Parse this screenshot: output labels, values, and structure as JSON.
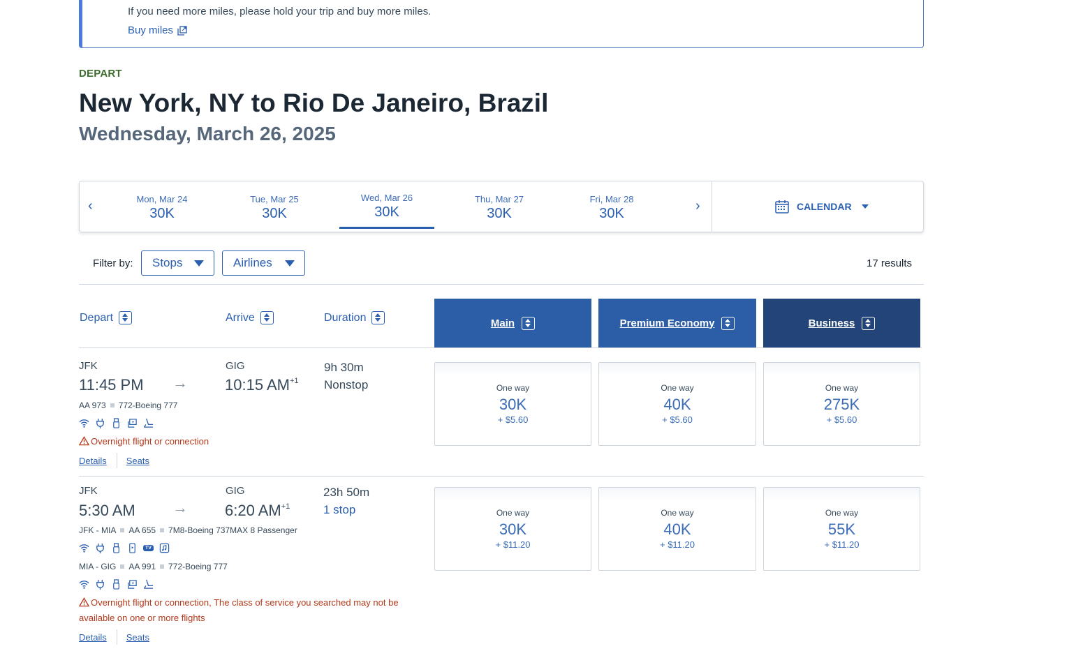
{
  "notice": {
    "text": "If you need more miles, please hold your trip and buy more miles.",
    "link": "Buy miles",
    "link_icon": "external-link-icon"
  },
  "header": {
    "depart_label": "DEPART",
    "title": "New York, NY to Rio De Janeiro, Brazil",
    "date": "Wednesday, March 26, 2025"
  },
  "date_strip": {
    "days": [
      {
        "label": "Mon, Mar 24",
        "price": "30K"
      },
      {
        "label": "Tue, Mar 25",
        "price": "30K"
      },
      {
        "label": "Wed, Mar 26",
        "price": "30K",
        "selected": true
      },
      {
        "label": "Thu, Mar 27",
        "price": "30K"
      },
      {
        "label": "Fri, Mar 28",
        "price": "30K"
      }
    ],
    "prev": "‹",
    "next": "›",
    "calendar_label": "CALENDAR"
  },
  "filters": {
    "label": "Filter by:",
    "stops": "Stops",
    "airlines": "Airlines",
    "results": "17 results"
  },
  "columns": {
    "depart": "Depart",
    "arrive": "Arrive",
    "duration": "Duration",
    "main": "Main",
    "premium": "Premium Economy",
    "business": "Business"
  },
  "flights": [
    {
      "from": "JFK",
      "dep_time": "11:45 PM",
      "to": "GIG",
      "arr_time": "10:15 AM",
      "day_offset": "+1",
      "duration": "9h 30m",
      "stops": "Nonstop",
      "segments": [
        {
          "route": "",
          "flight": "AA 973",
          "aircraft": "772-Boeing 777",
          "amenities": [
            "wifi-icon",
            "power-icon",
            "usb-icon",
            "on-demand-video-icon",
            "lie-flat-seat-icon"
          ]
        }
      ],
      "warning": "Overnight flight or connection",
      "details": "Details",
      "seats": "Seats",
      "prices": [
        {
          "label": "One way",
          "miles": "30K",
          "fee": "+ $5.60"
        },
        {
          "label": "One way",
          "miles": "40K",
          "fee": "+ $5.60"
        },
        {
          "label": "One way",
          "miles": "275K",
          "fee": "+ $5.60"
        }
      ]
    },
    {
      "from": "JFK",
      "dep_time": "5:30 AM",
      "to": "GIG",
      "arr_time": "6:20 AM",
      "day_offset": "+1",
      "duration": "23h 50m",
      "stops": "1 stop",
      "segments": [
        {
          "route": "JFK - MIA",
          "flight": "AA 655",
          "aircraft": "7M8-Boeing 737MAX 8 Passenger",
          "amenities": [
            "wifi-icon",
            "power-icon",
            "usb-icon",
            "device-entertainment-icon",
            "live-tv-icon",
            "music-icon"
          ]
        },
        {
          "route": "MIA - GIG",
          "flight": "AA 991",
          "aircraft": "772-Boeing 777",
          "amenities": [
            "wifi-icon",
            "power-icon",
            "usb-icon",
            "on-demand-video-icon",
            "lie-flat-seat-icon"
          ]
        }
      ],
      "warning": "Overnight flight or connection, The class of service you searched may not be available on one or more flights",
      "details": "Details",
      "seats": "Seats",
      "tv_badge": "TV",
      "prices": [
        {
          "label": "One way",
          "miles": "30K",
          "fee": "+ $11.20"
        },
        {
          "label": "One way",
          "miles": "40K",
          "fee": "+ $11.20"
        },
        {
          "label": "One way",
          "miles": "55K",
          "fee": "+ $11.20"
        }
      ]
    }
  ]
}
